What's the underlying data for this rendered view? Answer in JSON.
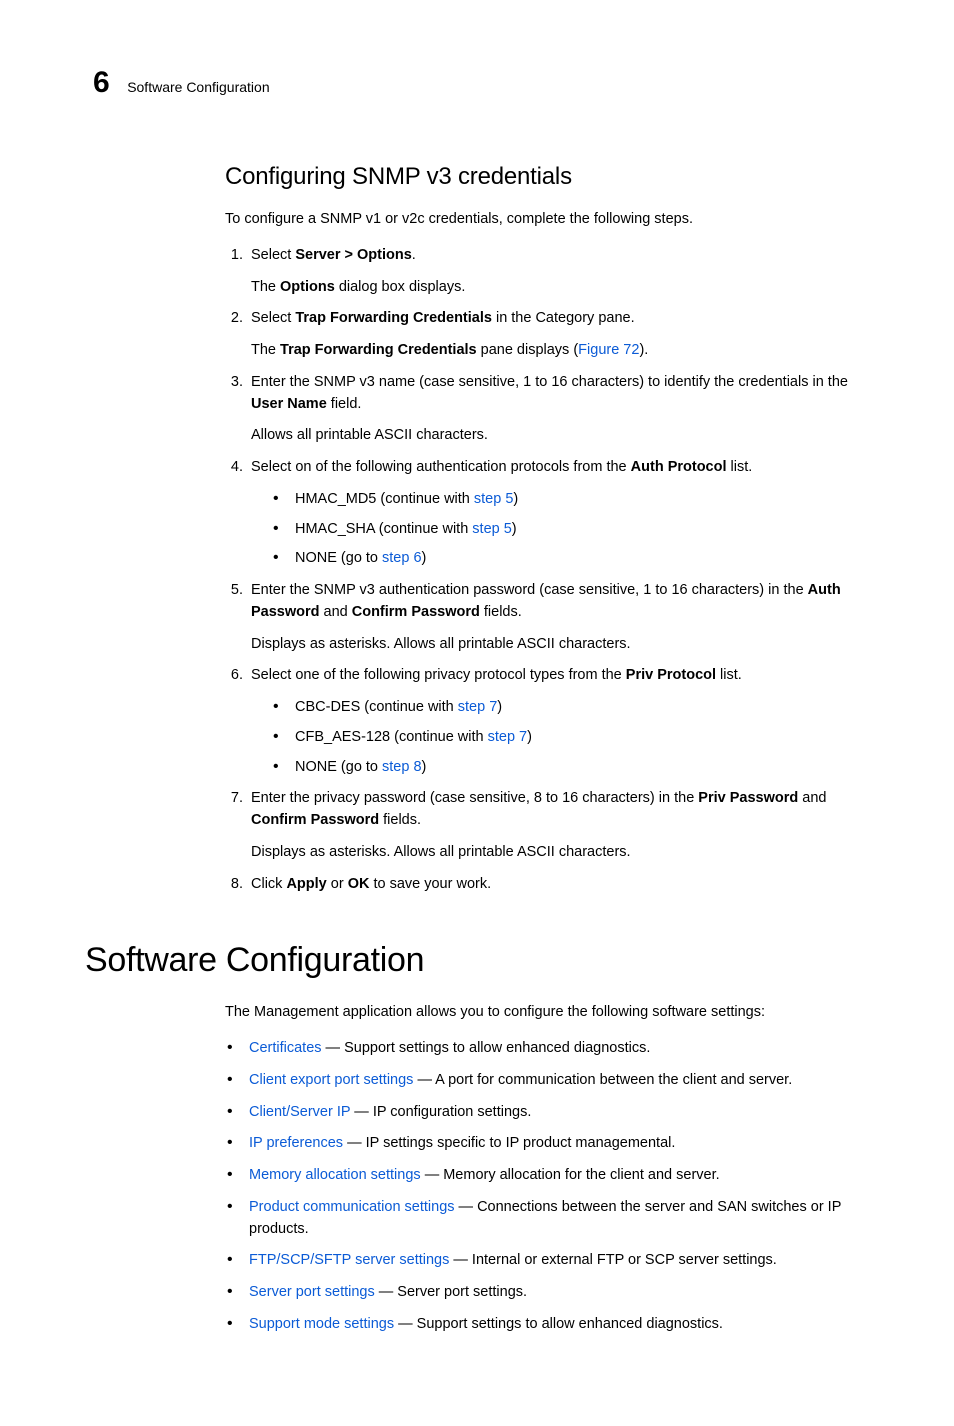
{
  "header": {
    "chapter_number": "6",
    "chapter_title": "Software Configuration"
  },
  "section1": {
    "heading": "Configuring SNMP v3 credentials",
    "intro": "To configure a SNMP v1 or v2c credentials, complete the following steps.",
    "step1": {
      "pre": "Select ",
      "bold": "Server > Options",
      "post": ".",
      "follow_pre": "The ",
      "follow_bold": "Options",
      "follow_post": " dialog box displays."
    },
    "step2": {
      "pre": "Select ",
      "bold": "Trap Forwarding Credentials",
      "post": " in the Category pane.",
      "follow_pre": "The ",
      "follow_bold": "Trap Forwarding Credentials",
      "follow_post1": " pane displays (",
      "follow_link": "Figure 72",
      "follow_post2": ")."
    },
    "step3": {
      "pre": "Enter the SNMP v3 name (case sensitive, 1 to 16 characters) to identify the credentials in the ",
      "bold": "User Name",
      "post": " field.",
      "follow": "Allows all printable ASCII characters."
    },
    "step4": {
      "pre": "Select on of the following authentication protocols from the ",
      "bold": "Auth Protocol",
      "post": " list.",
      "b1_pre": "HMAC_MD5 (continue with ",
      "b1_link": "step 5",
      "b1_post": ")",
      "b2_pre": "HMAC_SHA (continue with ",
      "b2_link": "step 5",
      "b2_post": ")",
      "b3_pre": "NONE (go to ",
      "b3_link": "step 6",
      "b3_post": ")"
    },
    "step5": {
      "pre": "Enter the SNMP v3 authentication password (case sensitive, 1 to 16 characters) in the ",
      "bold1": "Auth Password",
      "mid": " and ",
      "bold2": "Confirm Password",
      "post": " fields.",
      "follow": "Displays as asterisks. Allows all printable ASCII characters."
    },
    "step6": {
      "pre": "Select one of the following privacy protocol types from the ",
      "bold": "Priv Protocol",
      "post": " list.",
      "b1_pre": "CBC-DES (continue with ",
      "b1_link": "step 7",
      "b1_post": ")",
      "b2_pre": "CFB_AES-128 (continue with ",
      "b2_link": "step 7",
      "b2_post": ")",
      "b3_pre": "NONE (go to ",
      "b3_link": "step 8",
      "b3_post": ")"
    },
    "step7": {
      "pre": "Enter the privacy password (case sensitive, 8 to 16 characters) in the ",
      "bold1": "Priv Password",
      "mid": " and ",
      "bold2": "Confirm Password",
      "post": " fields.",
      "follow": "Displays as asterisks. Allows all printable ASCII characters."
    },
    "step8": {
      "pre": "Click ",
      "bold1": "Apply",
      "mid": " or ",
      "bold2": "OK",
      "post": " to save your work."
    }
  },
  "section2": {
    "heading": "Software Configuration",
    "intro": "The Management application allows you to configure the following software settings:",
    "items": [
      {
        "link": "Certificates",
        "desc": " — Support settings to allow enhanced diagnostics."
      },
      {
        "link": "Client export port settings",
        "desc": " — A port for communication between the client and server."
      },
      {
        "link": "Client/Server IP",
        "desc": " — IP configuration settings."
      },
      {
        "link": "IP preferences",
        "desc": " — IP settings specific to IP product managemental."
      },
      {
        "link": "Memory allocation settings",
        "desc": " — Memory allocation for the client and server."
      },
      {
        "link": "Product communication settings",
        "desc": " — Connections between the server and SAN switches or IP products."
      },
      {
        "link": "FTP/SCP/SFTP server settings",
        "desc": " — Internal or external FTP or SCP server settings."
      },
      {
        "link": "Server port settings",
        "desc": " — Server port settings."
      },
      {
        "link": "Support mode settings",
        "desc": " — Support settings to allow enhanced diagnostics."
      }
    ]
  }
}
